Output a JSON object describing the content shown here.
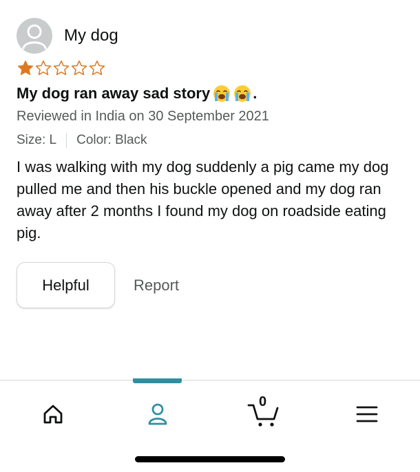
{
  "review": {
    "reviewer_name": "My dog",
    "rating": 1,
    "max_rating": 5,
    "title": "My dog ran away sad story",
    "title_emojis": [
      "loudly-crying-face",
      "loudly-crying-face"
    ],
    "title_suffix": ".",
    "reviewed_line": "Reviewed in India on 30 September 2021",
    "size": "Size: L",
    "color": "Color: Black",
    "body": "I was walking with my dog suddenly a pig came my dog pulled me and then his buckle opened and my dog ran away after 2 months I found my dog on roadside eating pig."
  },
  "actions": {
    "helpful_label": "Helpful",
    "report_label": "Report"
  },
  "navbar": {
    "items": [
      {
        "icon": "home-icon",
        "active": false
      },
      {
        "icon": "account-icon",
        "active": true
      },
      {
        "icon": "cart-icon",
        "active": false,
        "count": "0"
      },
      {
        "icon": "menu-icon",
        "active": false
      }
    ]
  },
  "colors": {
    "star_fill": "#de7921",
    "active_nav": "#2f8fa0",
    "secondary_text": "#565959",
    "primary_text": "#0f1111"
  }
}
